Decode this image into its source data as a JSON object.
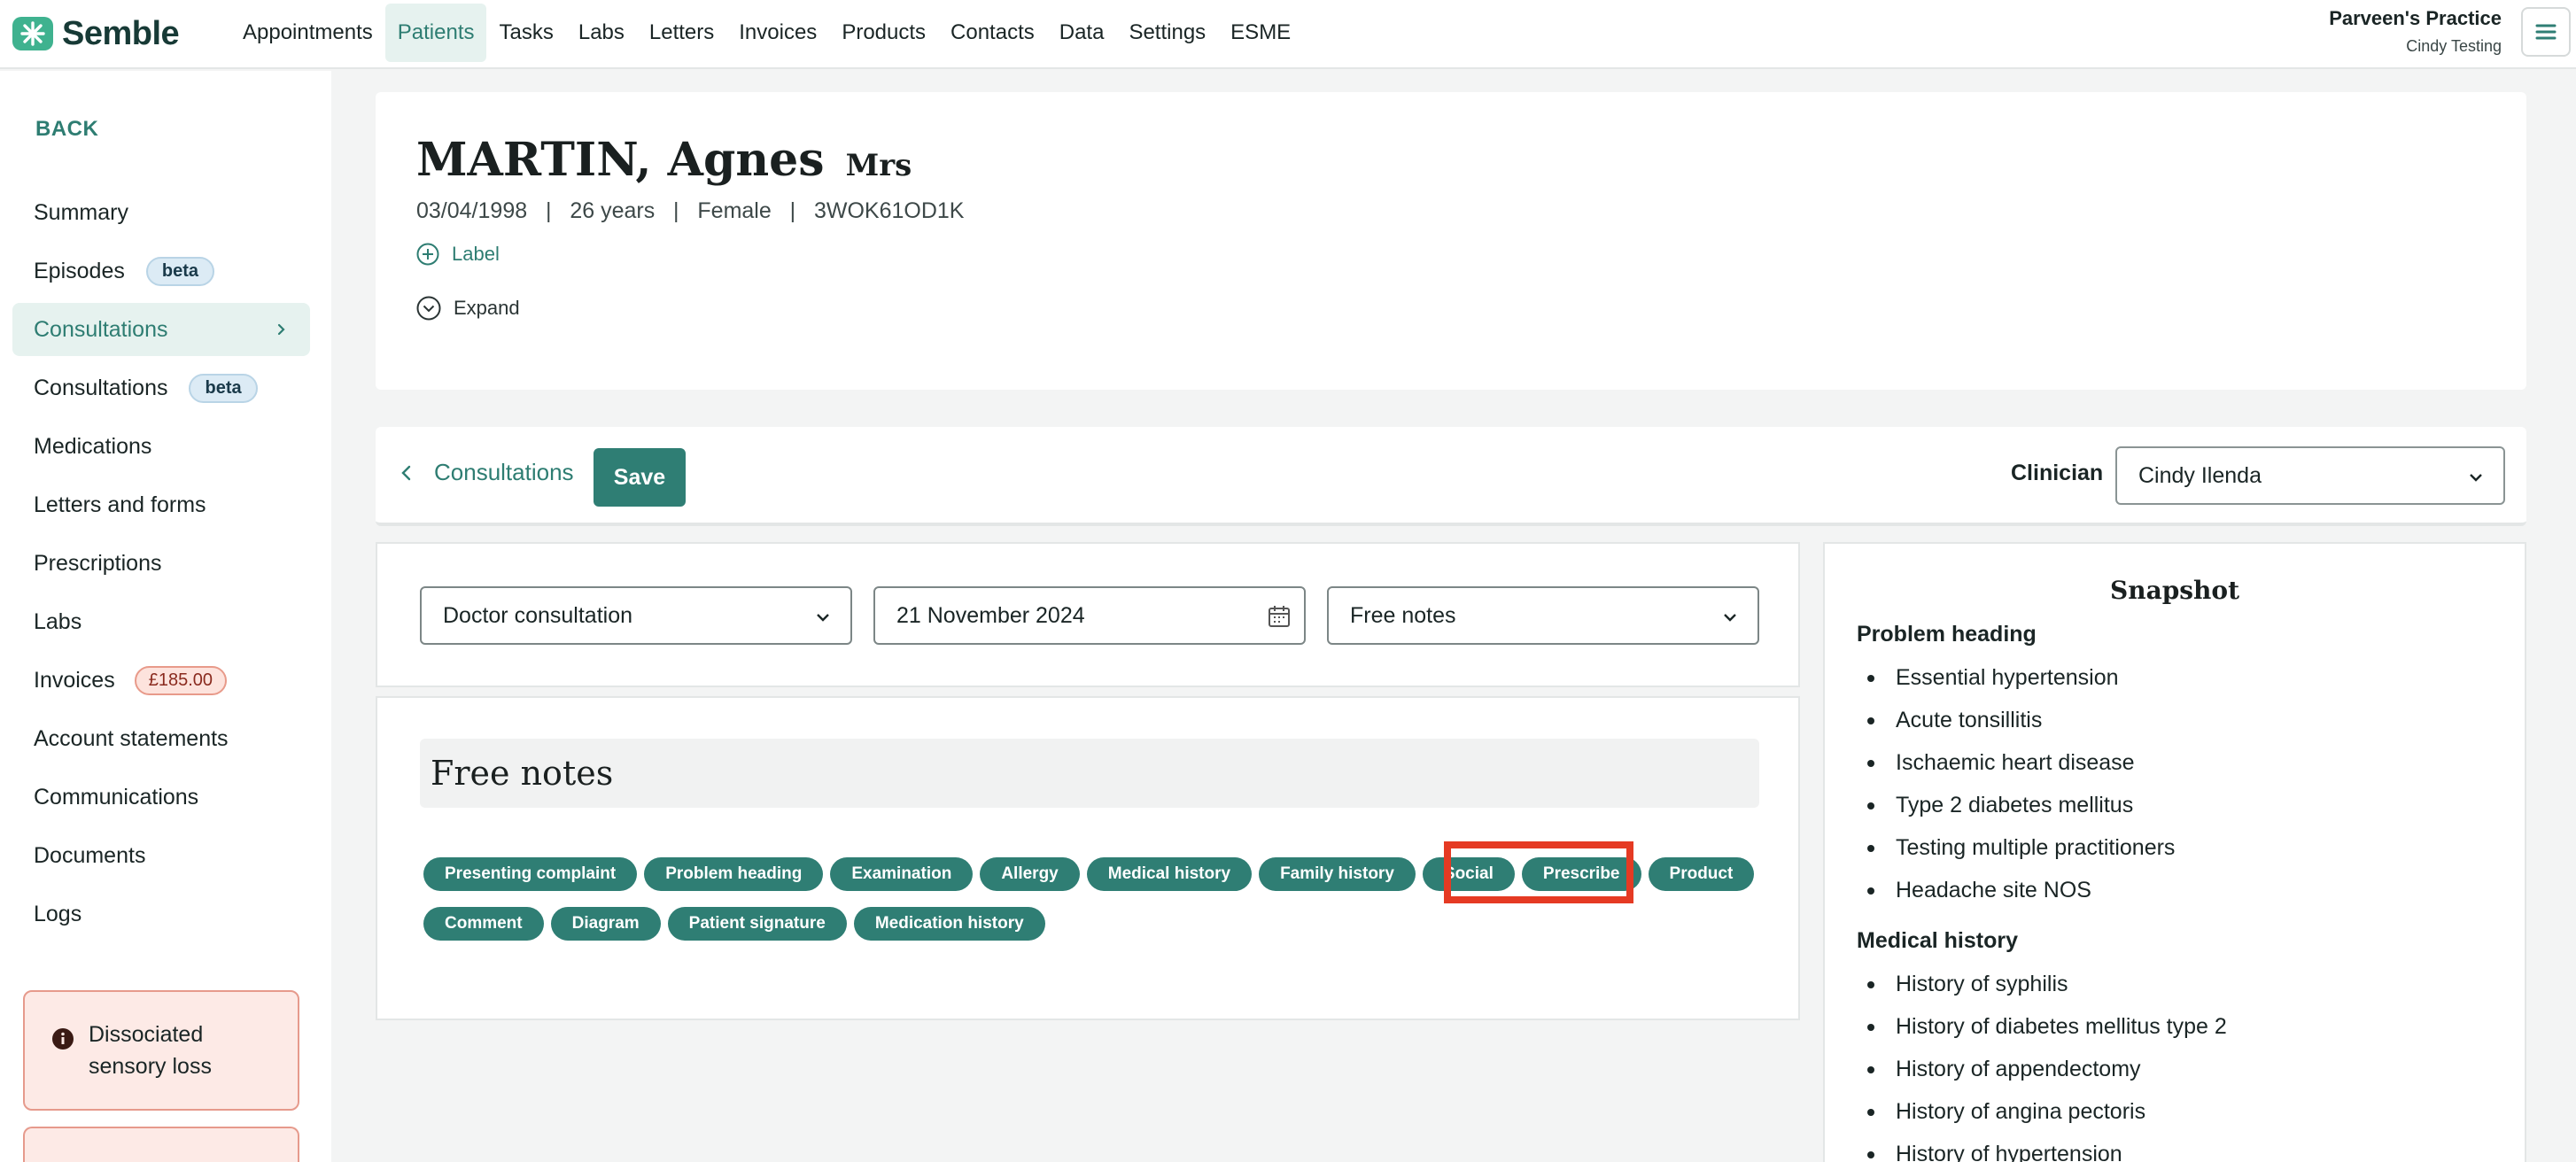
{
  "app": {
    "logo_text": "Semble",
    "brand_color": "#3fb28f",
    "accent_color": "#2f7e74",
    "practice_name": "Parveen's Practice",
    "user_name": "Cindy Testing",
    "menu_icon": "hamburger-icon"
  },
  "nav": {
    "items": [
      "Appointments",
      "Patients",
      "Tasks",
      "Labs",
      "Letters",
      "Invoices",
      "Products",
      "Contacts",
      "Data",
      "Settings",
      "ESME"
    ],
    "active": "Patients"
  },
  "sidebar": {
    "back_label": "BACK",
    "items": [
      {
        "label": "Summary"
      },
      {
        "label": "Episodes",
        "badge": "beta"
      },
      {
        "label": "Consultations",
        "active": true
      },
      {
        "label": "Consultations",
        "badge": "beta"
      },
      {
        "label": "Medications"
      },
      {
        "label": "Letters and forms"
      },
      {
        "label": "Prescriptions"
      },
      {
        "label": "Labs"
      },
      {
        "label": "Invoices",
        "amount": "£185.00"
      },
      {
        "label": "Account statements"
      },
      {
        "label": "Communications"
      },
      {
        "label": "Documents"
      },
      {
        "label": "Logs"
      }
    ],
    "alerts": [
      {
        "icon": "info-icon",
        "text": "Dissociated sensory loss"
      }
    ]
  },
  "patient": {
    "name": "MARTIN, Agnes",
    "title": "Mrs",
    "dob": "03/04/1998",
    "age": "26 years",
    "sex": "Female",
    "id": "3WOK61OD1K",
    "label_action": "Label",
    "expand_action": "Expand"
  },
  "consultation": {
    "back_label": "Consultations",
    "save_label": "Save",
    "clinician_label": "Clinician",
    "clinician_value": "Cindy Ilenda",
    "type_value": "Doctor consultation",
    "date_value": "21 November 2024",
    "template_value": "Free notes"
  },
  "notes": {
    "title": "Free notes",
    "chips_row1": [
      "Presenting complaint",
      "Problem heading",
      "Examination",
      "Allergy",
      "Medical history",
      "Family history",
      "Social",
      "Prescribe",
      "Product"
    ],
    "chips_row2": [
      "Comment",
      "Diagram",
      "Patient signature",
      "Medication history"
    ],
    "highlighted_chip": "Prescribe"
  },
  "snapshot": {
    "title": "Snapshot",
    "sections": [
      {
        "heading": "Problem heading",
        "items": [
          "Essential hypertension",
          "Acute tonsillitis",
          "Ischaemic heart disease",
          "Type 2 diabetes mellitus",
          "Testing multiple practitioners",
          "Headache site NOS"
        ]
      },
      {
        "heading": "Medical history",
        "items": [
          "History of syphilis",
          "History of diabetes mellitus type 2",
          "History of appendectomy",
          "History of angina pectoris",
          "History of hypertension"
        ]
      }
    ]
  }
}
